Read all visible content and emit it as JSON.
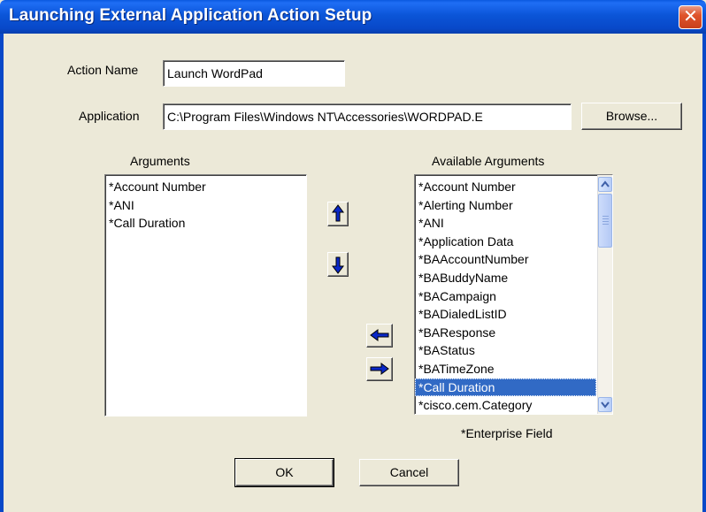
{
  "window": {
    "title": "Launching External Application Action Setup",
    "close_glyph": "✕"
  },
  "form": {
    "action_name_label": "Action Name",
    "action_name_value": "Launch WordPad",
    "application_label": "Application",
    "application_value": "C:\\Program Files\\Windows NT\\Accessories\\WORDPAD.E",
    "browse_label": "Browse..."
  },
  "arguments": {
    "label": "Arguments",
    "items": [
      "*Account Number",
      "*ANI",
      "*Call Duration"
    ]
  },
  "available": {
    "label": "Available Arguments",
    "items": [
      "*Account Number",
      "*Alerting Number",
      "*ANI",
      "*Application Data",
      "*BAAccountNumber",
      "*BABuddyName",
      "*BACampaign",
      "*BADialedListID",
      "*BAResponse",
      "*BAStatus",
      "*BATimeZone",
      "*Call Duration",
      "*cisco.cem.Category"
    ],
    "selected": "*Call Duration",
    "footnote": "*Enterprise Field"
  },
  "buttons": {
    "ok_label": "OK",
    "cancel_label": "Cancel"
  },
  "icons": {
    "move_up": "arrow-up-icon",
    "move_down": "arrow-down-icon",
    "add_left": "arrow-left-icon",
    "remove_right": "arrow-right-icon"
  },
  "colors": {
    "arrow": "#0a28c8",
    "selection": "#316ac5",
    "title_bar": "#0a55d8",
    "background": "#ece9d8"
  }
}
